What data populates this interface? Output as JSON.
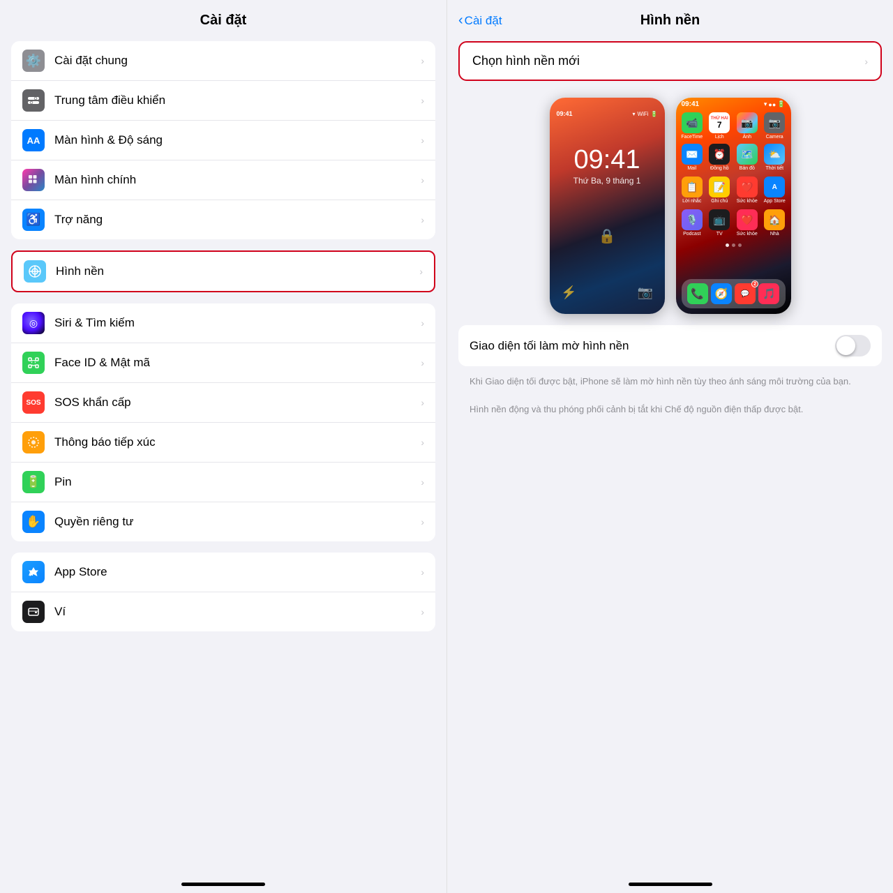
{
  "left": {
    "header": "Cài đặt",
    "groups": [
      {
        "id": "group1",
        "items": [
          {
            "id": "cai-dat-chung",
            "label": "Cài đặt chung",
            "icon": "gear",
            "iconBg": "gray",
            "symbol": "⚙️"
          },
          {
            "id": "trung-tam",
            "label": "Trung tâm điều khiển",
            "icon": "toggle",
            "iconBg": "gray2",
            "symbol": "⊞"
          },
          {
            "id": "man-hinh-sang",
            "label": "Màn hình & Độ sáng",
            "icon": "AA",
            "iconBg": "blue",
            "symbol": "AA"
          },
          {
            "id": "man-hinh-chinh",
            "label": "Màn hình chính",
            "icon": "grid",
            "iconBg": "colorful",
            "symbol": "⊞"
          },
          {
            "id": "tro-nang",
            "label": "Trợ năng",
            "icon": "person",
            "iconBg": "blue2",
            "symbol": "♿"
          }
        ]
      },
      {
        "id": "group2-highlighted",
        "items": [
          {
            "id": "hinh-nen",
            "label": "Hình nền",
            "icon": "flower",
            "iconBg": "wallpaper",
            "symbol": "✿",
            "highlighted": true
          }
        ]
      },
      {
        "id": "group3",
        "items": [
          {
            "id": "siri",
            "label": "Siri & Tìm kiếm",
            "icon": "siri",
            "iconBg": "siri",
            "symbol": "◉"
          },
          {
            "id": "face-id",
            "label": "Face ID & Mật mã",
            "icon": "face",
            "iconBg": "green-face",
            "symbol": "🙂"
          },
          {
            "id": "sos",
            "label": "SOS khẩn cấp",
            "icon": "sos",
            "iconBg": "red-sos",
            "symbol": "SOS"
          },
          {
            "id": "thong-bao",
            "label": "Thông báo tiếp xúc",
            "icon": "contact",
            "iconBg": "contact",
            "symbol": "✦"
          },
          {
            "id": "pin",
            "label": "Pin",
            "icon": "battery",
            "iconBg": "green-bat",
            "symbol": "🔋"
          },
          {
            "id": "quyen",
            "label": "Quyền riêng tư",
            "icon": "hand",
            "iconBg": "blue-hand",
            "symbol": "✋"
          }
        ]
      },
      {
        "id": "group4",
        "items": [
          {
            "id": "app-store",
            "label": "App Store",
            "icon": "appstore",
            "iconBg": "appstore",
            "symbol": "A"
          },
          {
            "id": "vi",
            "label": "Ví",
            "icon": "wallet",
            "iconBg": "wallet",
            "symbol": "▤"
          }
        ]
      }
    ]
  },
  "right": {
    "back_label": "Cài đặt",
    "title": "Hình nền",
    "choose_label": "Chọn hình nền mới",
    "toggle_label": "Giao diện tối làm mờ hình nền",
    "toggle_state": false,
    "desc1": "Khi Giao diện tối được bật, iPhone sẽ làm mờ hình nền tùy theo ánh sáng môi trường của bạn.",
    "desc2": "Hình nền động và thu phóng phối cảnh bị tắt khi Chế độ nguồn điện thấp được bật.",
    "lockscreen": {
      "time": "09:41",
      "date": "Thứ Ba, 9 tháng 1"
    },
    "homescreen": {
      "status_time": "09:41"
    }
  },
  "icons": {
    "chevron": "›",
    "back_chevron": "‹"
  }
}
